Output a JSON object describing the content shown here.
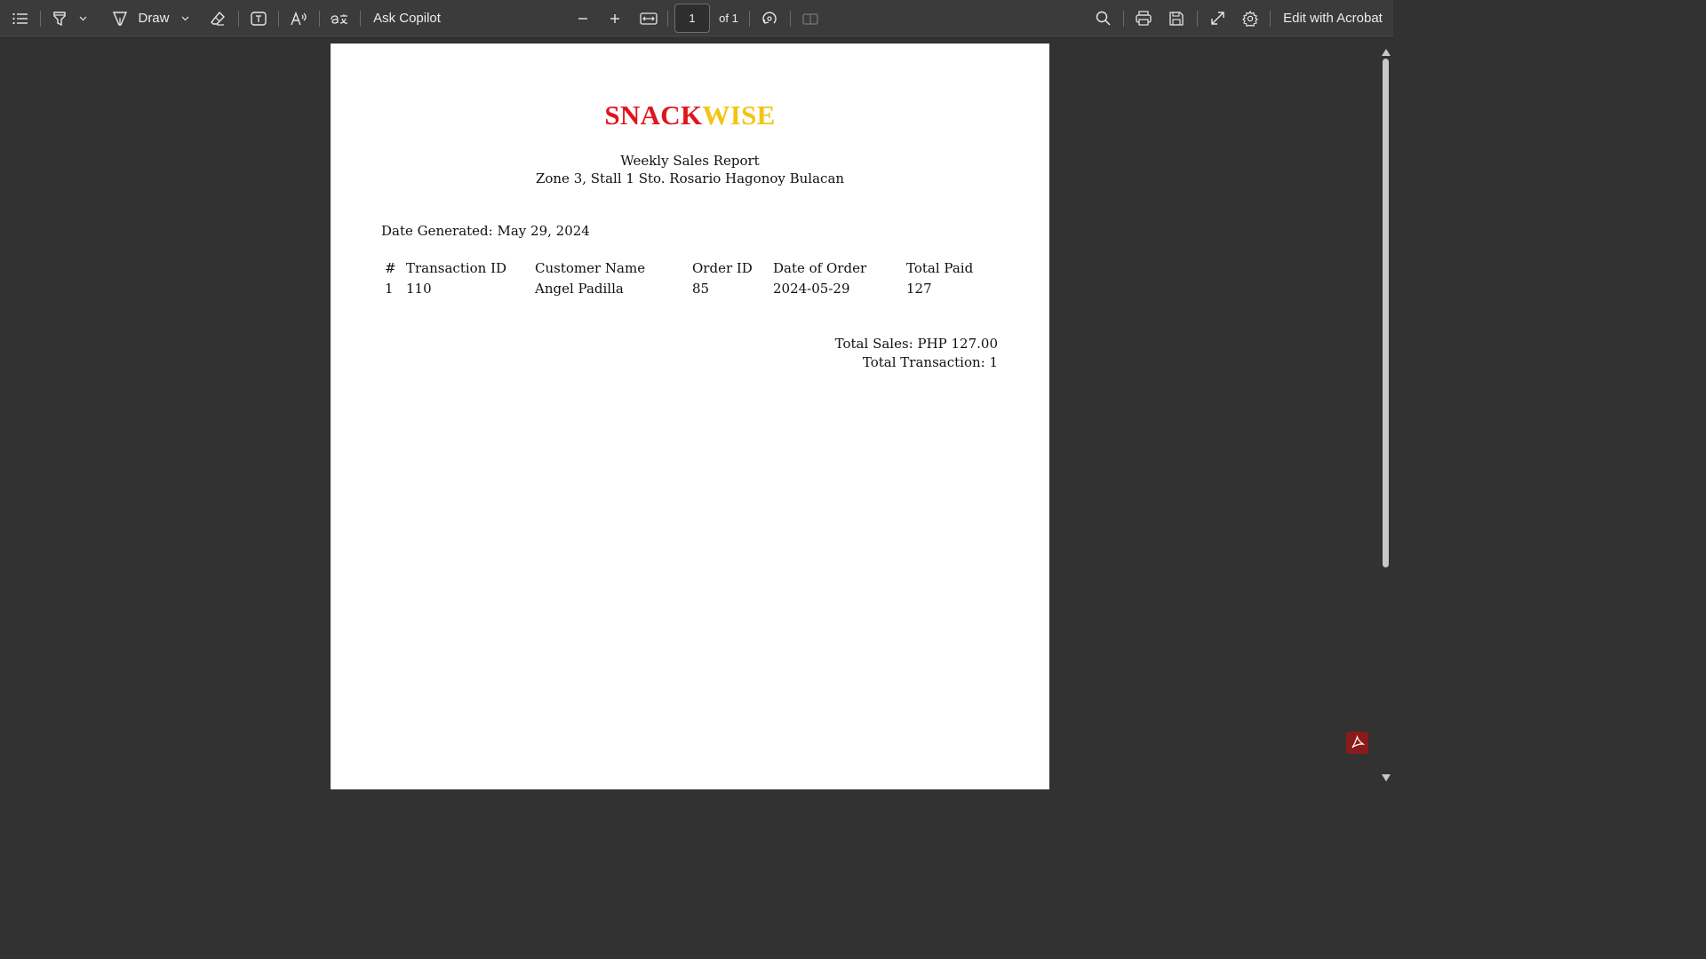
{
  "toolbar": {
    "draw_label": "Draw",
    "ask_copilot_label": "Ask Copilot",
    "page_number": "1",
    "page_total": "of 1",
    "edit_label": "Edit with Acrobat"
  },
  "icons": {
    "contents": "list-icon",
    "highlight": "highlighter-icon",
    "draw": "pen-icon",
    "erase": "eraser-icon",
    "text": "text-box-icon",
    "read_aloud": "read-aloud-icon",
    "translate": "translate-icon",
    "zoom_out": "minus-icon",
    "zoom_in": "plus-icon",
    "fit": "fit-page-icon",
    "rotate": "rotate-icon",
    "two_page": "two-page-icon",
    "search": "search-icon",
    "print": "print-icon",
    "save": "save-icon",
    "fullscreen": "expand-icon",
    "settings": "gear-icon",
    "acrobat": "acrobat-icon"
  },
  "document": {
    "brand_part1": "SNACK",
    "brand_part2": "WISE",
    "brand_color1": "#e0161c",
    "brand_color2": "#f2c514",
    "report_title": "Weekly Sales Report",
    "address": "Zone 3, Stall 1 Sto. Rosario Hagonoy Bulacan",
    "date_generated": "Date Generated: May 29, 2024",
    "table": {
      "headers": [
        "#",
        "Transaction ID",
        "Customer Name",
        "Order ID",
        "Date of Order",
        "Total Paid"
      ],
      "rows": [
        [
          "1",
          "110",
          "Angel Padilla",
          "85",
          "2024-05-29",
          "127"
        ]
      ]
    },
    "total_sales": "Total Sales: PHP 127.00",
    "total_transaction": "Total Transaction: 1"
  }
}
